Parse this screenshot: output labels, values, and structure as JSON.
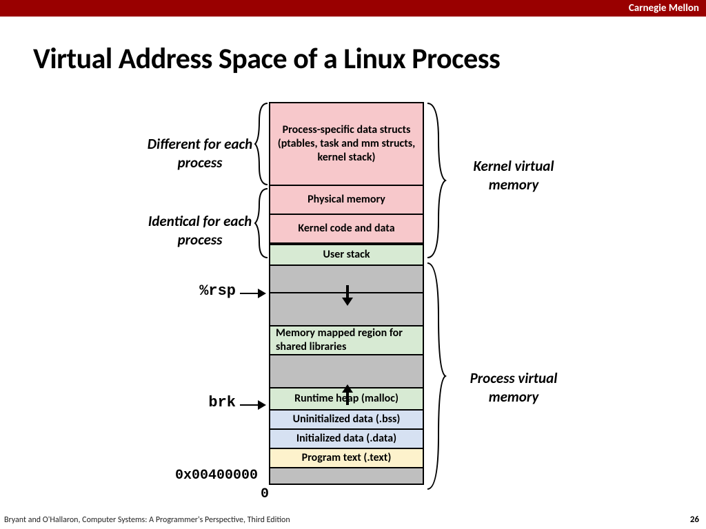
{
  "brand": "Carnegie Mellon",
  "title": "Virtual Address Space of a Linux Process",
  "segments": {
    "proc_specific": "Process-specific data structs  (ptables, task and mm structs, kernel stack)",
    "phys_mem": "Physical memory",
    "kernel_code": "Kernel code and data",
    "user_stack": "User stack",
    "mmap_region": "Memory mapped region for shared libraries",
    "heap": "Runtime heap (malloc)",
    "bss": "Uninitialized data (.bss)",
    "data": "Initialized data (.data)",
    "text": "Program text (.text)"
  },
  "callouts": {
    "different": "Different for each process",
    "identical": "Identical  for each process",
    "kernel_vm": "Kernel virtual memory",
    "process_vm": "Process virtual memory"
  },
  "pointers": {
    "rsp": "%rsp",
    "brk": "brk",
    "text_base": "0x00400000",
    "zero": "0"
  },
  "footer": "Bryant and O'Hallaron, Computer Systems: A Programmer's Perspective, Third Edition",
  "page": "26"
}
